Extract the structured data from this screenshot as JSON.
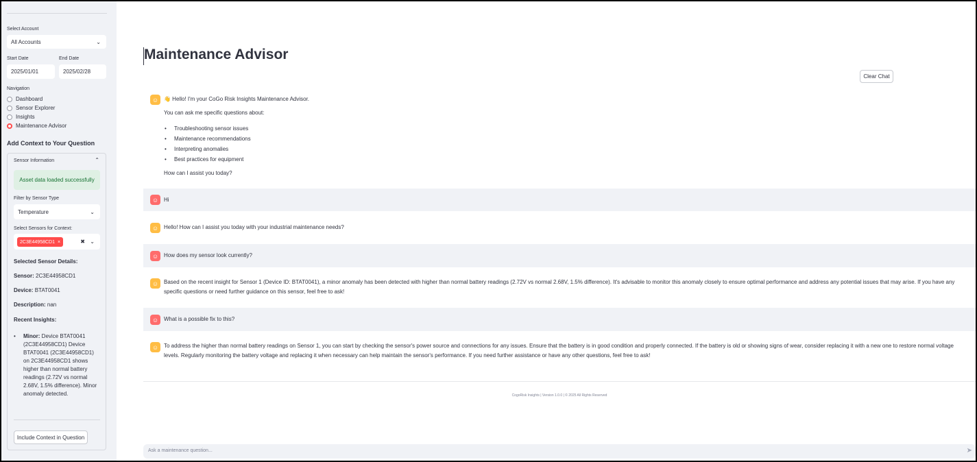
{
  "sidebar": {
    "account_label": "Select Account",
    "account_value": "All Accounts",
    "start_label": "Start Date",
    "start_value": "2025/01/01",
    "end_label": "End Date",
    "end_value": "2025/02/28",
    "nav_label": "Navigation",
    "nav_items": [
      "Dashboard",
      "Sensor Explorer",
      "Insights",
      "Maintenance Advisor"
    ],
    "nav_selected": "Maintenance Advisor",
    "context_heading": "Add Context to Your Question",
    "expander_title": "Sensor Information",
    "success_msg": "Asset data loaded successfully",
    "filter_label": "Filter by Sensor Type",
    "filter_value": "Temperature",
    "sensors_label": "Select Sensors for Context:",
    "sensor_tag": "2C3E44958CD1",
    "details_heading": "Selected Sensor Details:",
    "sensor_key": "Sensor:",
    "sensor_val": "2C3E44958CD1",
    "device_key": "Device:",
    "device_val": "BTAT0041",
    "desc_key": "Description:",
    "desc_val": "nan",
    "recent_heading": "Recent Insights:",
    "insight_key": "Minor:",
    "insight_text": "Device BTAT0041 (2C3E44958CD1) Device BTAT0041 (2C3E44958CD1) on 2C3E44958CD1 shows higher than normal battery readings (2.72V vs normal 2.68V, 1.5% difference). Minor anomaly detected.",
    "include_button": "Include Context in Question"
  },
  "main": {
    "title": "Maintenance Advisor",
    "clear_button": "Clear Chat",
    "welcome_line": "👋 Hello! I'm your CoGo Risk Insights Maintenance Advisor.",
    "welcome_sub": "You can ask me specific questions about:",
    "welcome_items": [
      "Troubleshooting sensor issues",
      "Maintenance recommendations",
      "Interpreting anomalies",
      "Best practices for equipment"
    ],
    "welcome_end": "How can I assist you today?",
    "messages": [
      {
        "role": "user",
        "text": "Hi"
      },
      {
        "role": "assistant",
        "text": "Hello! How can I assist you today with your industrial maintenance needs?"
      },
      {
        "role": "user",
        "text": "How does my sensor look currently?"
      },
      {
        "role": "assistant",
        "text": "Based on the recent insight for Sensor 1 (Device ID: BTAT0041), a minor anomaly has been detected with higher than normal battery readings (2.72V vs normal 2.68V, 1.5% difference). It's advisable to monitor this anomaly closely to ensure optimal performance and address any potential issues that may arise. If you have any specific questions or need further guidance on this sensor, feel free to ask!"
      },
      {
        "role": "user",
        "text": "What is a possible fix to this?"
      },
      {
        "role": "assistant",
        "text": "To address the higher than normal battery readings on Sensor 1, you can start by checking the sensor's power source and connections for any issues. Ensure that the battery is in good condition and properly connected. If the battery is old or showing signs of wear, consider replacing it with a new one to restore normal voltage levels. Regularly monitoring the battery voltage and replacing it when necessary can help maintain the sensor's performance. If you need further assistance or have any other questions, feel free to ask!"
      }
    ],
    "footer": "CogoRisk Insights | Version 1.0.0 | © 2025 All Rights Reserved",
    "input_placeholder": "Ask a maintenance question..."
  },
  "colors": {
    "accent": "#ff4b4b",
    "bot_avatar": "#ffbd45",
    "user_avatar": "#ff6c6c",
    "sidebar_bg": "#f0f2f6"
  }
}
